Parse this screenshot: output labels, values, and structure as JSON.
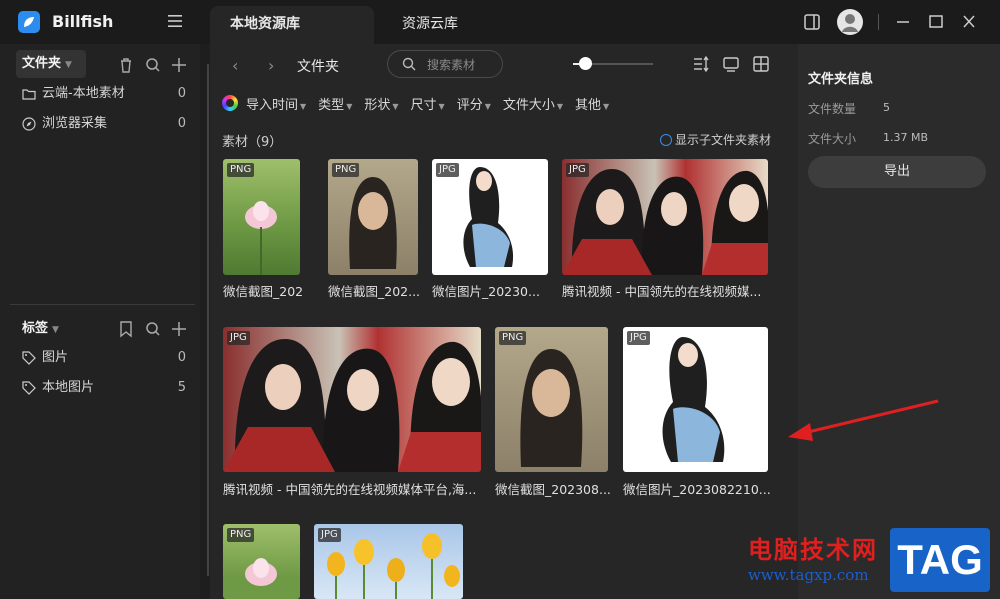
{
  "app": {
    "name": "Billfish"
  },
  "tabs": [
    {
      "label": "本地资源库"
    },
    {
      "label": "资源云库"
    }
  ],
  "sidebar": {
    "folder_header": "文件夹",
    "folders": [
      {
        "label": "云端-本地素材",
        "count": "0",
        "icon": "cloud-folder-icon"
      },
      {
        "label": "浏览器采集",
        "count": "0",
        "icon": "compass-icon"
      }
    ],
    "tags_header": "标签",
    "tags": [
      {
        "label": "图片",
        "count": "0",
        "icon": "tag-icon"
      },
      {
        "label": "本地图片",
        "count": "5",
        "icon": "tag-icon"
      }
    ]
  },
  "toolbar": {
    "breadcrumb": "文件夹",
    "search_placeholder": "搜索素材"
  },
  "filters": [
    "导入时间",
    "类型",
    "形状",
    "尺寸",
    "评分",
    "文件大小",
    "其他"
  ],
  "content": {
    "count_label": "素材（9）",
    "show_subfolders": "显示子文件夹素材",
    "items": [
      {
        "badge": "PNG",
        "caption": "微信截图_202..."
      },
      {
        "badge": "PNG",
        "caption": "微信截图_202..."
      },
      {
        "badge": "JPG",
        "caption": "微信图片_20230..."
      },
      {
        "badge": "JPG",
        "caption": "腾讯视频 - 中国领先的在线视频媒..."
      },
      {
        "badge": "JPG",
        "caption": "腾讯视频 - 中国领先的在线视频媒体平台,海..."
      },
      {
        "badge": "PNG",
        "caption": "微信截图_202308..."
      },
      {
        "badge": "JPG",
        "caption": "微信图片_2023082210..."
      },
      {
        "badge": "PNG",
        "caption": ""
      },
      {
        "badge": "JPG",
        "caption": ""
      }
    ]
  },
  "info_panel": {
    "title": "文件夹信息",
    "file_count_label": "文件数量",
    "file_count": "5",
    "file_size_label": "文件大小",
    "file_size": "1.37 MB",
    "export_label": "导出"
  },
  "watermark": {
    "site_name": "电脑技术网",
    "url": "www.tagxp.com",
    "logo": "TAG"
  },
  "colors": {
    "accent": "#2d8cf0",
    "annotation_arrow": "#e02020",
    "watermark_red": "#e01f1f",
    "watermark_blue": "#1763c8"
  }
}
